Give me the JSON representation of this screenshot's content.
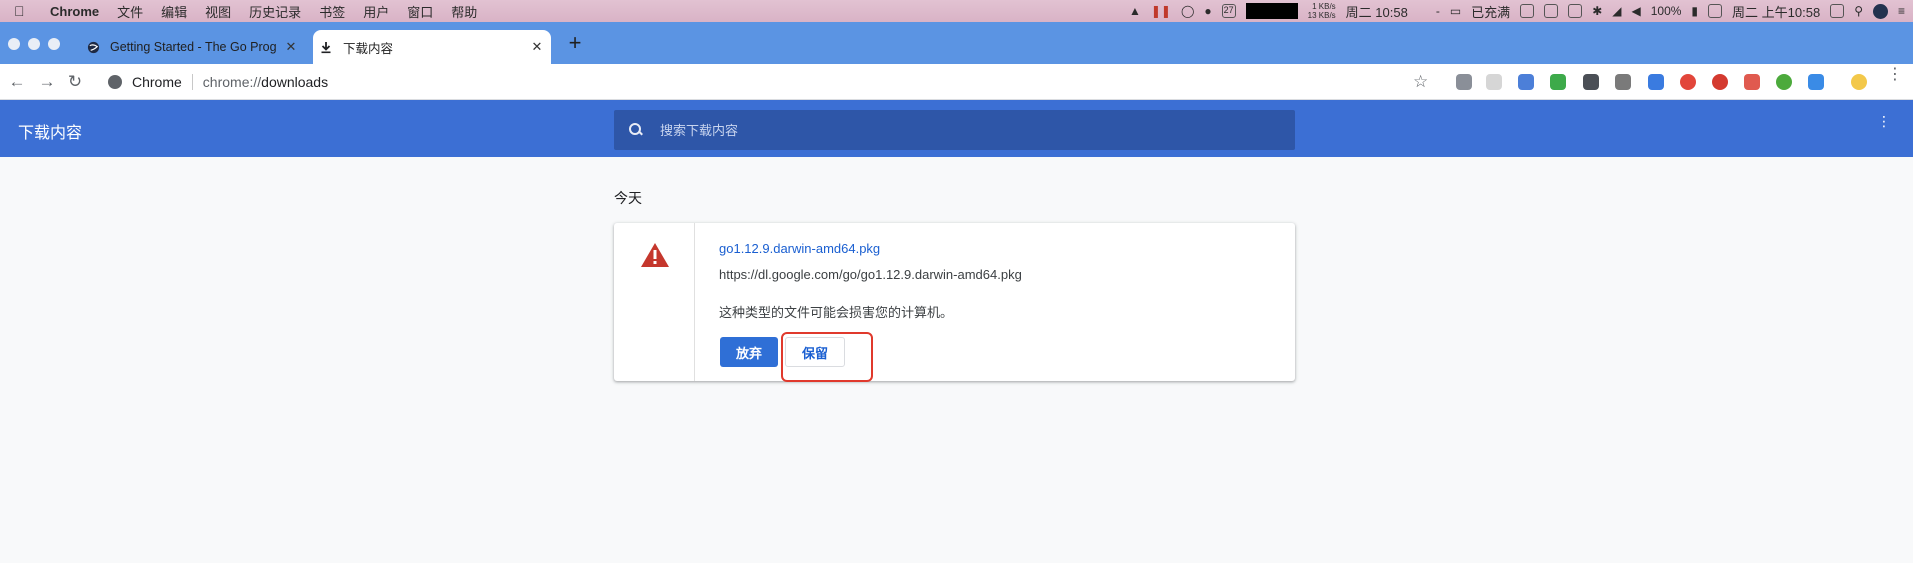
{
  "menubar": {
    "app_name": "Chrome",
    "items": [
      "文件",
      "编辑",
      "视图",
      "历史记录",
      "书签",
      "用户",
      "窗口",
      "帮助"
    ],
    "calendar_day": "27",
    "net_up": "1 KB/s",
    "net_down": "13 KB/s",
    "clock": "周二 10:58",
    "dash": "-",
    "battery_status": "已充满",
    "battery_percent": "100%",
    "clock_full": "周二 上午10:58"
  },
  "tabs": [
    {
      "title": "Getting Started - The Go Prog",
      "active": false
    },
    {
      "title": "下载内容",
      "active": true
    }
  ],
  "toolbar": {
    "site_label": "Chrome",
    "url_scheme": "chrome://",
    "url_path": "downloads"
  },
  "downloads": {
    "header_title": "下载内容",
    "search_placeholder": "搜索下载内容",
    "section_title": "今天",
    "item": {
      "filename": "go1.12.9.darwin-amd64.pkg",
      "url": "https://dl.google.com/go/go1.12.9.darwin-amd64.pkg",
      "warning": "这种类型的文件可能会损害您的计算机。",
      "discard_label": "放弃",
      "keep_label": "保留"
    }
  },
  "colors": {
    "tabstrip": "#5b94e3",
    "header": "#3c6fd4",
    "accent": "#1a5fd1",
    "warning_icon": "#c5372d",
    "highlight": "#e0392c"
  }
}
